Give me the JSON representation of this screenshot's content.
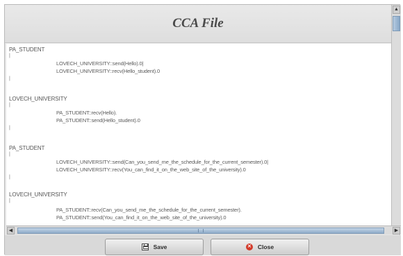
{
  "window": {
    "title": "CCA File"
  },
  "content": {
    "blocks": [
      {
        "header": "PA_STUDENT",
        "lines": [
          "LOVECH_UNIVERSITY::send(Hello).0|",
          "LOVECH_UNIVERSITY::recv(Hello_student).0"
        ]
      },
      {
        "header": "LOVECH_UNIVERSITY",
        "lines": [
          "PA_STUDENT::recv(Hello).",
          "PA_STUDENT::send(Hello_student).0"
        ]
      },
      {
        "header": "PA_STUDENT",
        "lines": [
          "LOVECH_UNIVERSITY::send(Can_you_send_me_the_schedule_for_the_current_semester).0|",
          "LOVECH_UNIVERSITY::recv(You_can_find_it_on_the_web_site_of_the_university).0"
        ]
      },
      {
        "header": "LOVECH_UNIVERSITY",
        "lines": [
          "PA_STUDENT::recv(Can_you_send_me_the_schedule_for_the_current_semester).",
          "PA_STUDENT::send(You_can_find_it_on_the_web_site_of_the_university).0"
        ]
      }
    ]
  },
  "buttons": {
    "save_label": "Save",
    "close_label": "Close"
  },
  "icons": {
    "save": "floppy-disk-icon",
    "close": "red-x-circle-icon"
  },
  "colors": {
    "background": "#e6e6e6",
    "scroll_thumb": "#9fb8d2",
    "close_icon": "#d23a2a"
  }
}
